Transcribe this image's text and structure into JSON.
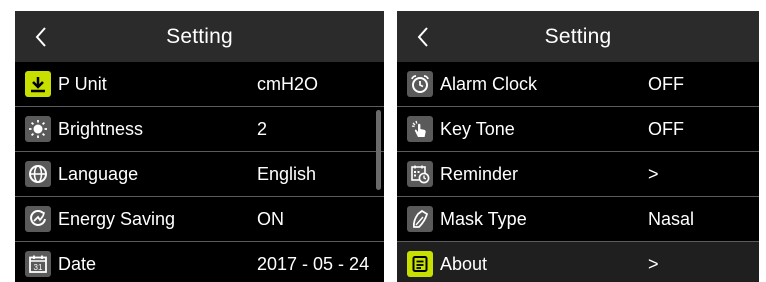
{
  "left_screen": {
    "title": "Setting",
    "items": [
      {
        "label": "P Unit",
        "value": "cmH2O",
        "icon": "download-icon",
        "highlighted": true
      },
      {
        "label": "Brightness",
        "value": "2",
        "icon": "brightness-icon"
      },
      {
        "label": "Language",
        "value": "English",
        "icon": "globe-icon"
      },
      {
        "label": "Energy Saving",
        "value": "ON",
        "icon": "energy-saving-icon"
      },
      {
        "label": "Date",
        "value": "2017 - 05 - 24",
        "icon": "calendar-icon",
        "icon_text": "31"
      }
    ]
  },
  "right_screen": {
    "title": "Setting",
    "items": [
      {
        "label": "Alarm Clock",
        "value": "OFF",
        "icon": "alarm-clock-icon"
      },
      {
        "label": "Key Tone",
        "value": "OFF",
        "icon": "hand-touch-icon"
      },
      {
        "label": "Reminder",
        "value": ">",
        "icon": "calendar-clock-icon"
      },
      {
        "label": "Mask Type",
        "value": "Nasal",
        "icon": "mask-icon"
      },
      {
        "label": "About",
        "value": ">",
        "icon": "document-icon",
        "highlighted": true
      }
    ]
  },
  "colors": {
    "screen_bg": "#000000",
    "header_bg": "#2b2b2b",
    "divider": "#5b5b5b",
    "icon_bg": "#5a5a5a",
    "highlight": "#c8e000",
    "text": "#ffffff"
  }
}
